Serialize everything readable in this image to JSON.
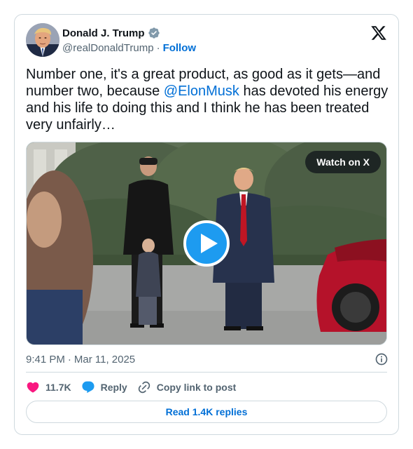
{
  "author": {
    "name": "Donald J. Trump",
    "handle": "@realDonaldTrump",
    "separator": "·",
    "follow_label": "Follow",
    "verified": true
  },
  "tweet": {
    "text_before": "Number one, it's a great product, as good as it gets—and number two, because ",
    "mention": "@ElonMusk",
    "text_after": " has devoted his energy and his life to doing this and I think he has been treated very unfairly…"
  },
  "media": {
    "watch_label": "Watch on X",
    "play_icon": "play-icon"
  },
  "meta": {
    "time": "9:41 PM",
    "separator": "·",
    "date": "Mar 11, 2025"
  },
  "actions": {
    "likes": "11.7K",
    "reply_label": "Reply",
    "copy_label": "Copy link to post"
  },
  "read_replies_label": "Read 1.4K replies",
  "colors": {
    "link": "#006fd6",
    "heart": "#f91880",
    "reply_bubble": "#1d9bf0",
    "verified_badge": "#829aab",
    "border": "#cfd9de",
    "muted_text": "#536471"
  }
}
